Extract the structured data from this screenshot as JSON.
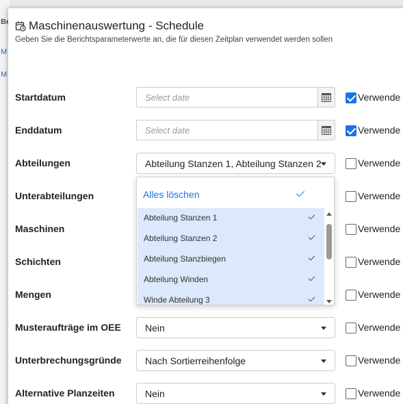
{
  "background": {
    "col1": "Be",
    "col2": "M",
    "col3": "M"
  },
  "dialog": {
    "title": "Maschinenauswertung - Schedule",
    "subtitle": "Geben Sie die Berichtsparameterwerte an, die für diesen Zeitplan verwendet werden sollen",
    "use_label": "Verwende"
  },
  "params": {
    "startdatum": {
      "label": "Startdatum",
      "placeholder": "Select date",
      "use": true
    },
    "enddatum": {
      "label": "Enddatum",
      "placeholder": "Select date",
      "use": true
    },
    "abteilungen": {
      "label": "Abteilungen",
      "value": "Abteilung Stanzen 1, Abteilung Stanzen 2",
      "use": false
    },
    "unterabteilungen": {
      "label": "Unterabteilungen",
      "use": false
    },
    "maschinen": {
      "label": "Maschinen",
      "use": false
    },
    "schichten": {
      "label": "Schichten",
      "use": false
    },
    "mengen": {
      "label": "Mengen",
      "use": false
    },
    "musterauftraege": {
      "label": "Musteraufträge im OEE",
      "value": "Nein",
      "use": false
    },
    "unterbrechungsgruende": {
      "label": "Unterbrechungsgründe",
      "value": "Nach Sortierreihenfolge",
      "use": false
    },
    "planzeiten": {
      "label": "Alternative Planzeiten",
      "value": "Nein",
      "use": false
    }
  },
  "dropdown": {
    "clear_all": "Alles löschen",
    "options": [
      "Abteilung Stanzen 1",
      "Abteilung Stanzen 2",
      "Abteilung Stanzbiegen",
      "Abteilung Winden",
      "Winde Abteilung 3"
    ]
  },
  "colors": {
    "accent": "#1a73e8",
    "selected_option_bg": "#dce8fb"
  }
}
